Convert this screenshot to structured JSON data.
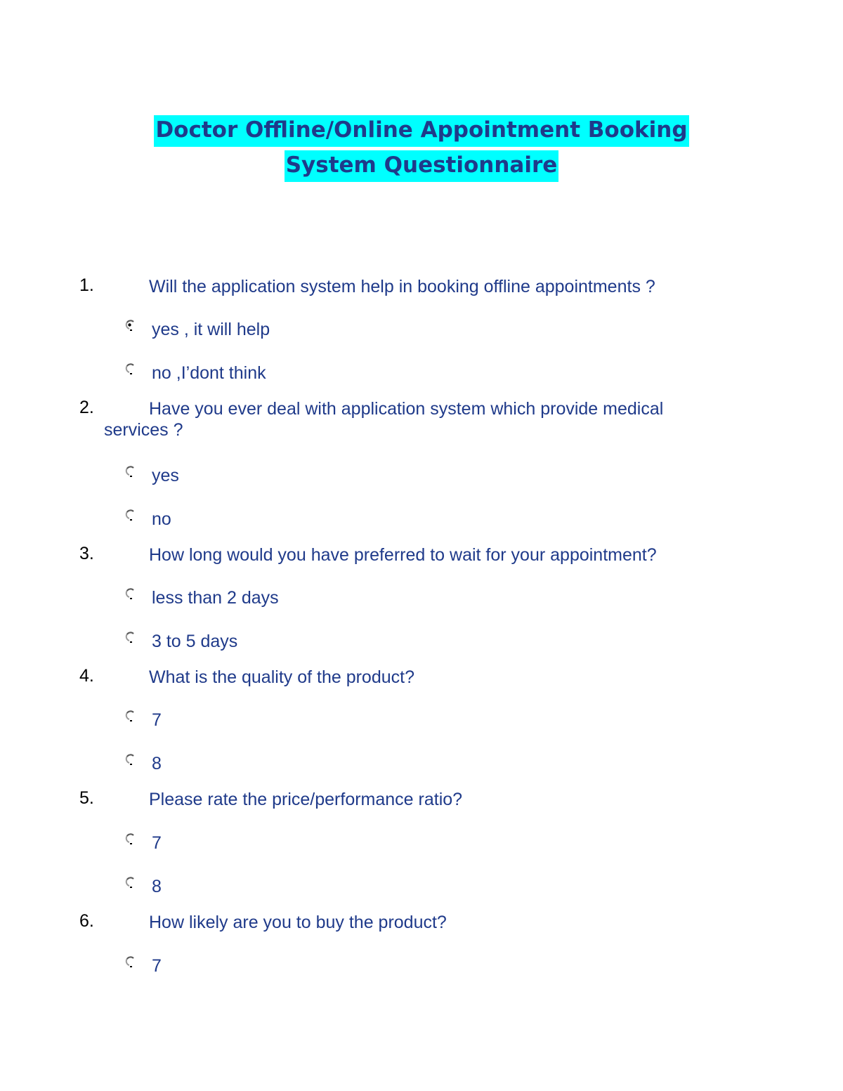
{
  "document": {
    "title_line1": "Doctor Offline/Online Appointment Booking",
    "title_line2": "System Questionnaire",
    "title_highlight_color": "#00ffff",
    "text_color": "#1f3a8a",
    "questions": [
      {
        "number": "1.",
        "text": "Will the application system help in booking offline appointments ?",
        "options": [
          {
            "label": "yes , it will help",
            "selected": true
          },
          {
            "label": "no ,I’dont think",
            "selected": false
          }
        ]
      },
      {
        "number": "2.",
        "text": "Have you ever deal with application system which provide medical",
        "text_cont": "services ?",
        "options": [
          {
            "label": "yes",
            "selected": false
          },
          {
            "label": "no",
            "selected": false
          }
        ]
      },
      {
        "number": "3.",
        "text": "How long would you have preferred to wait for your appointment?",
        "options": [
          {
            "label": "less than 2 days",
            "selected": false
          },
          {
            "label": "3 to 5 days",
            "selected": false
          }
        ]
      },
      {
        "number": "4.",
        "text": "What is the quality of the product?",
        "options": [
          {
            "label": "7",
            "selected": false
          },
          {
            "label": "8",
            "selected": false
          }
        ]
      },
      {
        "number": "5.",
        "text": "Please rate the price/performance ratio?",
        "options": [
          {
            "label": "7",
            "selected": false
          },
          {
            "label": "8",
            "selected": false
          }
        ]
      },
      {
        "number": "6.",
        "text": "How likely are you to buy the product?",
        "options": [
          {
            "label": "7",
            "selected": false
          }
        ]
      }
    ]
  }
}
